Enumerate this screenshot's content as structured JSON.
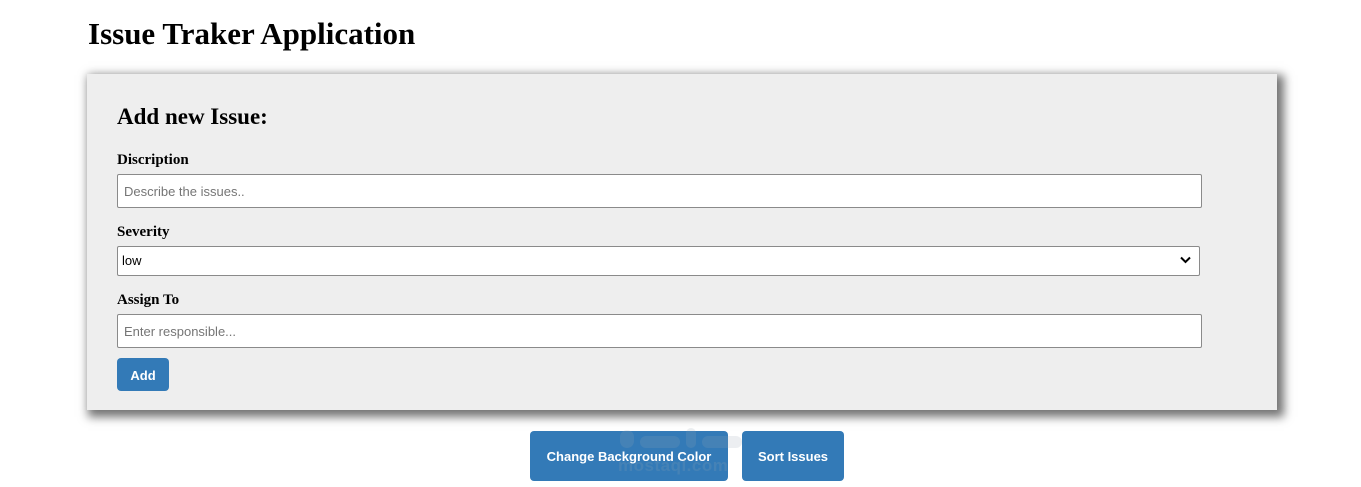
{
  "app": {
    "title": "Issue Traker Application"
  },
  "form": {
    "heading": "Add new Issue:",
    "description": {
      "label": "Discription",
      "placeholder": "Describe the issues..",
      "value": ""
    },
    "severity": {
      "label": "Severity",
      "selected": "low"
    },
    "assign_to": {
      "label": "Assign To",
      "placeholder": "Enter responsible...",
      "value": ""
    },
    "add_label": "Add"
  },
  "actions": {
    "change_bg_label": "Change Background Color",
    "sort_label": "Sort Issues"
  },
  "watermark": {
    "text": "mostaql.com"
  },
  "colors": {
    "accent": "#337ab7",
    "card_bg": "#eeeeee"
  }
}
